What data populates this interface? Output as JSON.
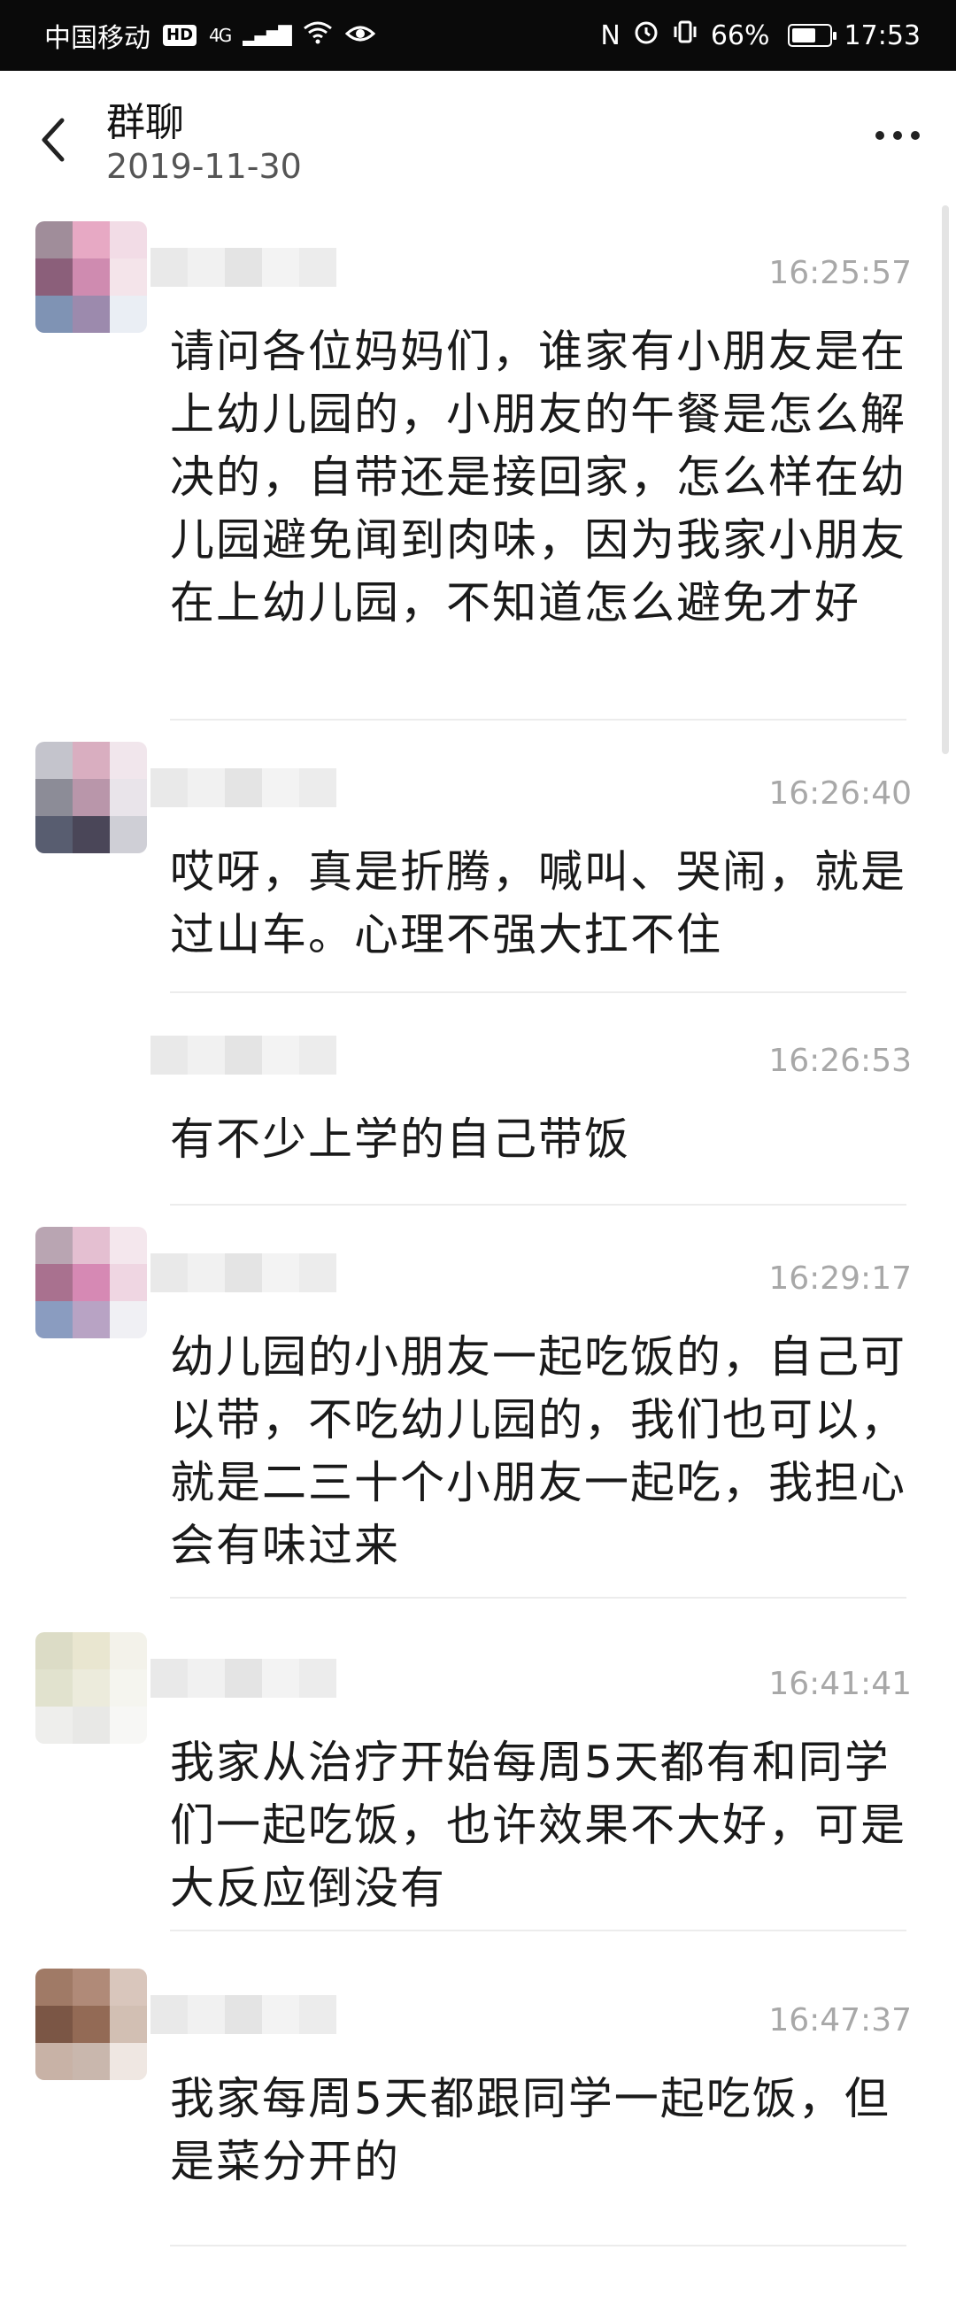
{
  "status_bar": {
    "carrier": "中国移动",
    "hd": "HD",
    "network": "4G",
    "nfc": "N",
    "battery": "66%",
    "battery_level": 0.66,
    "time": "17:53"
  },
  "header": {
    "title": "群聊",
    "date": "2019-11-30"
  },
  "colors": {
    "status_bar_bg": "#0a0a0a",
    "timestamp": "#a8a8a8",
    "message_text": "#1a1a1a"
  },
  "messages": [
    {
      "time": "16:25:57",
      "text": "请问各位妈妈们，谁家有小朋友是在上幼儿园的，小朋友的午餐是怎么解决的，自带还是接回家，怎么样在幼儿园避免闻到肉味，因为我家小朋友在上幼儿园，不知道怎么避免才好",
      "avatar_colors": [
        "#a08d9a",
        "#e7a9c4",
        "#f2dce6",
        "#8b5f7a",
        "#cf8bb0",
        "#f4e4ea",
        "#7f93b4",
        "#9c8aad",
        "#eaeef4"
      ]
    },
    {
      "time": "16:26:40",
      "text": "哎呀，真是折腾，喊叫、哭闹，就是过山车。心理不强大扛不住",
      "avatar_colors": [
        "#c4c4cc",
        "#d9aec0",
        "#f1e6ec",
        "#8c8c97",
        "#b996aa",
        "#e9e4ea",
        "#585d70",
        "#4a4658",
        "#cfcfd6"
      ]
    },
    {
      "time": "16:26:53",
      "text": "有不少上学的自己带饭",
      "avatar_colors": []
    },
    {
      "time": "16:29:17",
      "text": "幼儿园的小朋友一起吃饭的，自己可以带，不吃幼儿园的，我们也可以，就是二三十个小朋友一起吃，我担心会有味过来",
      "avatar_colors": [
        "#b9a5b2",
        "#e4bfd1",
        "#f4e7ed",
        "#a9718f",
        "#d689b4",
        "#efd6e2",
        "#8a9cc0",
        "#b8a3c4",
        "#f0f0f4"
      ]
    },
    {
      "time": "16:41:41",
      "text": "我家从治疗开始每周5天都有和同学们一起吃饭，也许效果不大好，可是大反应倒没有",
      "avatar_colors": [
        "#dcdcc6",
        "#e9e6d0",
        "#f3f2ea",
        "#e1e2ce",
        "#ecebdc",
        "#f5f5ef",
        "#eeeeec",
        "#e8e8e6",
        "#f7f7f5"
      ]
    },
    {
      "time": "16:47:37",
      "text": "我家每周5天都跟同学一起吃饭，但是菜分开的",
      "avatar_colors": [
        "#a07a66",
        "#b08a78",
        "#d9c6bc",
        "#7b5645",
        "#936a55",
        "#d2bfb3",
        "#c8b2a6",
        "#c9b7ad",
        "#efe7e2"
      ]
    }
  ]
}
